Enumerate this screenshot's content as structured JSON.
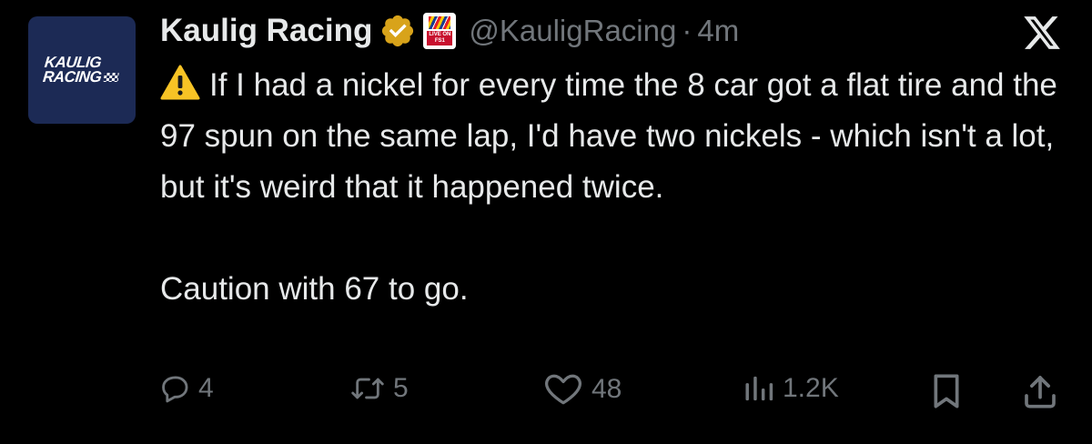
{
  "author": {
    "display_name": "Kaulig Racing",
    "handle": "@KauligRacing",
    "separator": "·",
    "time": "4m",
    "avatar_text_line1": "KAULIG",
    "avatar_text_line2": "RACING",
    "affiliate_badge_text_line1": "LIVE ON",
    "affiliate_badge_text_line2": "FS1",
    "verified_color": "#d8a31a"
  },
  "platform": {
    "logo_icon": "x-logo-icon"
  },
  "tweet": {
    "paragraph1": "If I had a nickel for every time the 8 car got a flat tire and the 97 spun on the same lap, I'd have two nickels - which isn't a lot, but it's weird that it happened twice.",
    "paragraph2": "Caution with 67 to go.",
    "lead_icon": "warning-icon"
  },
  "actions": {
    "replies": "4",
    "reposts": "5",
    "likes": "48",
    "views": "1.2K"
  },
  "colors": {
    "background": "#000000",
    "text": "#e7e9ea",
    "muted": "#71767b",
    "avatar_bg": "#1c2a55"
  }
}
